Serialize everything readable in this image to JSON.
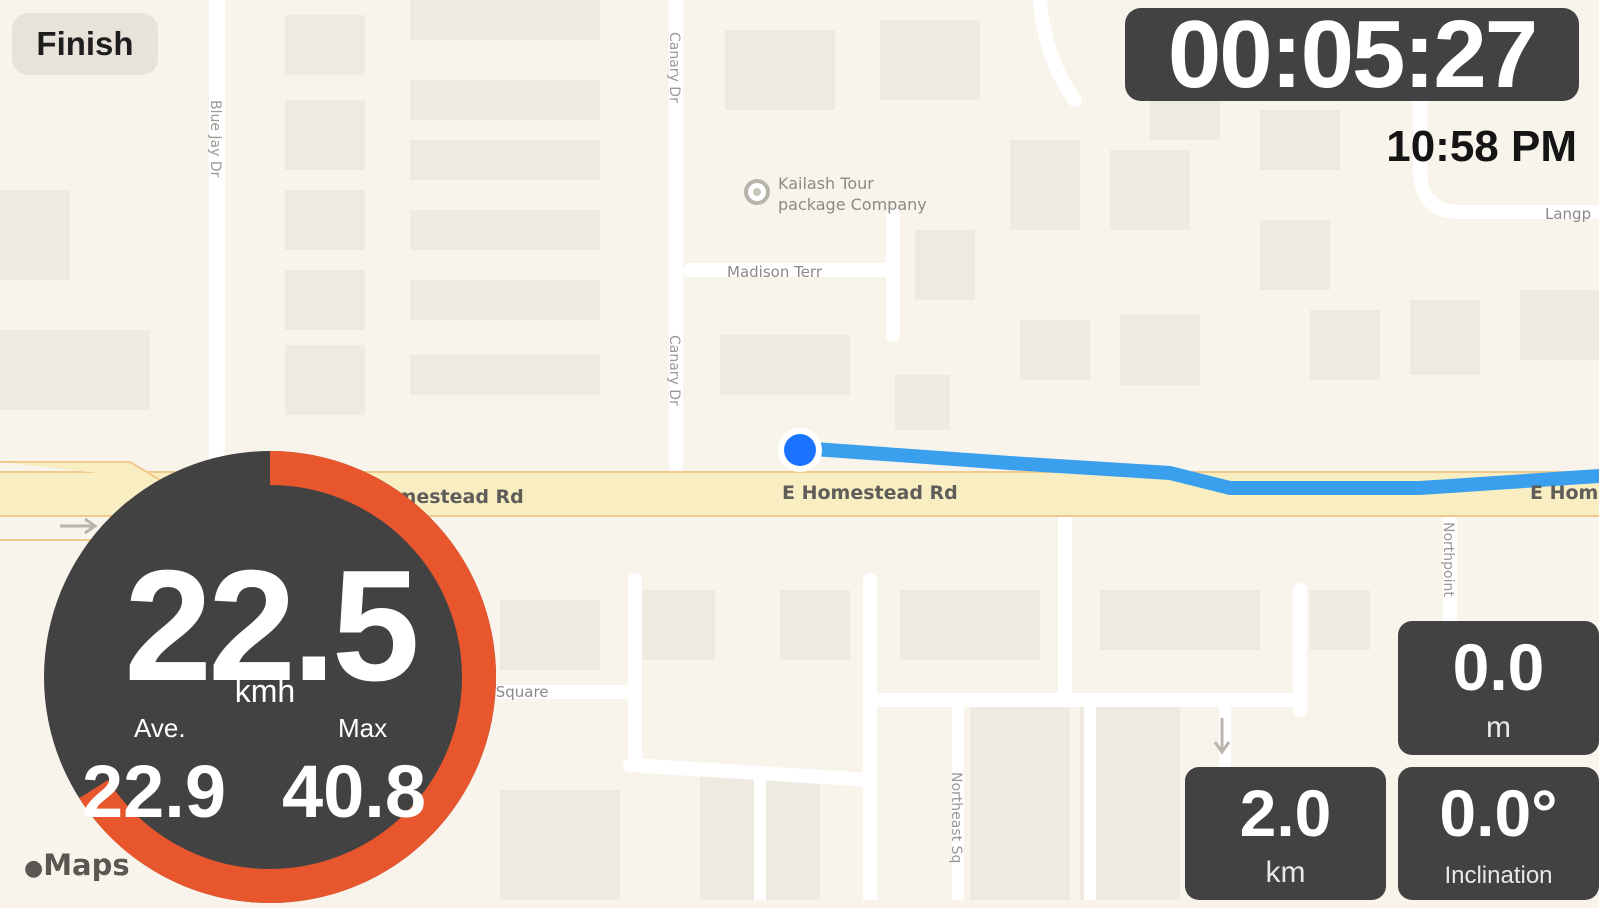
{
  "header": {
    "finish_label": "Finish",
    "elapsed_time": "00:05:27",
    "clock": "10:58 PM"
  },
  "map": {
    "poi_label_line1": "Kailash Tour",
    "poi_label_line2": "package Company",
    "street_madison": "Madison Terr",
    "street_canary_top": "Canary Dr",
    "street_canary_mid": "Canary Dr",
    "street_bluejay": "Blue Jay Dr",
    "street_homestead_1": "E Homestead Rd",
    "street_homestead_2": "E Homestead Rd",
    "street_homestead_3": "E Homes",
    "street_langp": "Langp",
    "street_northpoint": "Northpoint",
    "street_square": "Homestead Square",
    "street_northeast": "Northeast Sq",
    "attribution": "Maps",
    "route_color": "#3aa0ee",
    "location_dot_color": "#1a73ff"
  },
  "speed": {
    "current": "22.5",
    "unit": "kmh",
    "avg_label": "Ave.",
    "max_label": "Max",
    "avg_value": "22.9",
    "max_value": "40.8",
    "progress_fraction": 0.66,
    "ring_color": "#e8562e",
    "panel_color": "#424242"
  },
  "metrics": {
    "elevation_value": "0.0",
    "elevation_unit": "m",
    "distance_value": "2.0",
    "distance_unit": "km",
    "inclination_value": "0.0°",
    "inclination_label": "Inclination"
  }
}
